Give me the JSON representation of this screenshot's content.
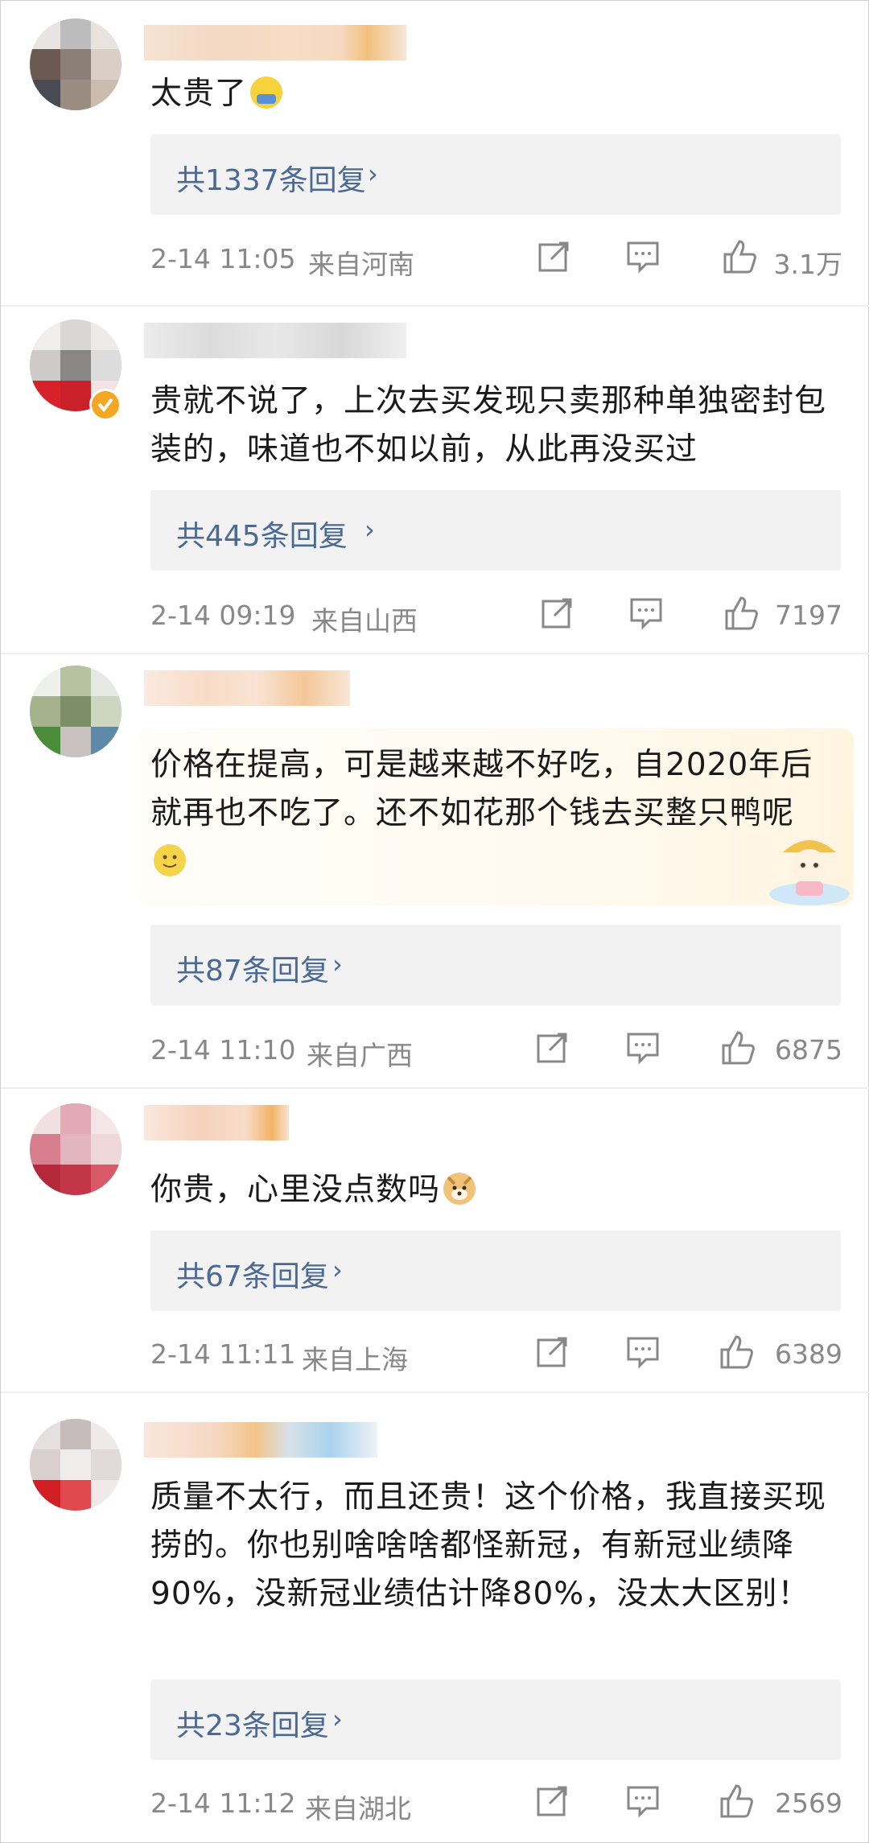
{
  "comments": [
    {
      "text": "太贵了",
      "emoji": "duckling-emoji",
      "replies_label": "共1337条回复",
      "time": "2-14 11:05",
      "location": "来自河南",
      "likes": "3.1万"
    },
    {
      "text": "贵就不说了，上次去买发现只卖那种单独密封包装的，味道也不如以前，从此再没买过",
      "replies_label": "共445条回复",
      "time": "2-14 09:19",
      "location": "来自山西",
      "likes": "7197"
    },
    {
      "text": "价格在提高，可是越来越不好吃，自2020年后就再也不吃了。还不如花那个钱去买整只鸭呢",
      "emoji": "smile-emoji",
      "replies_label": "共87条回复",
      "time": "2-14 11:10",
      "location": "来自广西",
      "likes": "6875"
    },
    {
      "text": "你贵，心里没点数吗",
      "emoji": "doge-emoji",
      "replies_label": "共67条回复",
      "time": "2-14 11:11",
      "location": "来自上海",
      "likes": "6389"
    },
    {
      "text": "质量不太行，而且还贵！这个价格，我直接买现捞的。你也别啥啥啥都怪新冠，有新冠业绩降90%，没新冠业绩估计降80%，没太大区别！",
      "replies_label": "共23条回复",
      "time": "2-14 11:12",
      "location": "来自湖北",
      "likes": "2569"
    }
  ],
  "icons": {
    "share": "share-icon",
    "comment": "comment-icon",
    "like": "thumbs-up-icon",
    "chevron": "chevron-right-icon",
    "verified": "verified-badge-icon"
  },
  "colors": {
    "reply_link": "#4a6a94",
    "reply_bg": "#f2f2f2",
    "meta_text": "#888888",
    "verified_badge": "#f5a623"
  }
}
